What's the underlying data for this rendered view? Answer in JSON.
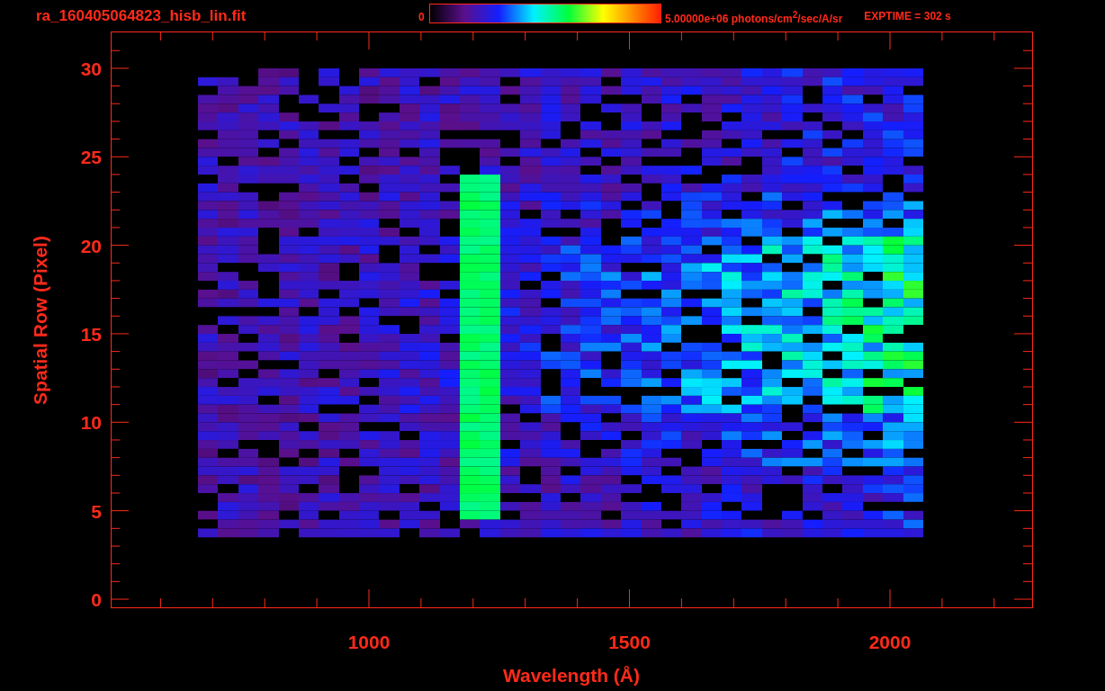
{
  "header": {
    "title": "ra_160405064823_hisb_lin.fit",
    "colorbar": {
      "min_label": "0",
      "max_label": "5.00000e+06 photons/cm$^{2}$/sec/A/sr"
    },
    "exptime": "EXPTIME = 302 s"
  },
  "plot": {
    "xlabel": "Wavelength (Å)",
    "ylabel": "Spatial Row (Pixel)",
    "xticks": [
      "1000",
      "1500",
      "2000"
    ],
    "yticks": [
      "30",
      "25",
      "20",
      "15",
      "10",
      "5",
      "0"
    ]
  }
}
